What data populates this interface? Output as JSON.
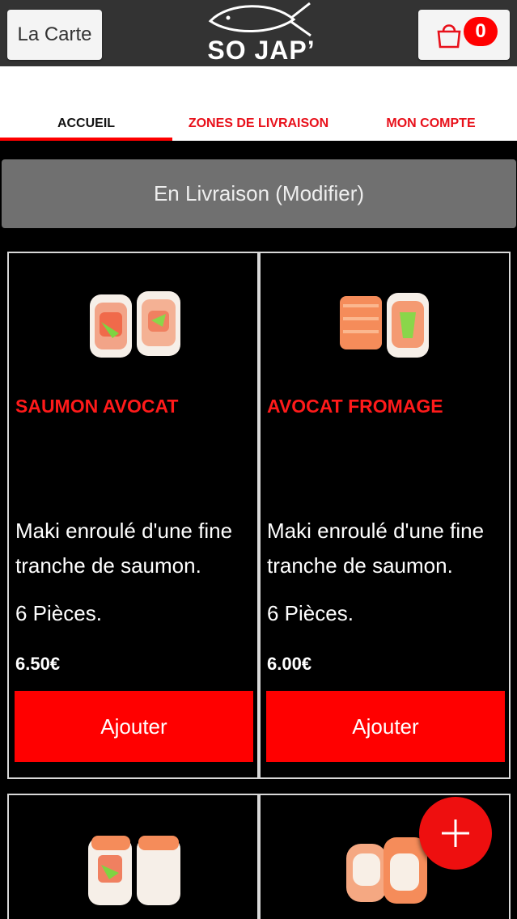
{
  "header": {
    "menu_button": "La Carte",
    "logo_text": "SO JAP’",
    "cart_count": "0"
  },
  "tabs": [
    {
      "label": "ACCUEIL",
      "active": true
    },
    {
      "label": "ZONES DE LIVRAISON",
      "active": false
    },
    {
      "label": "MON COMPTE",
      "active": false
    }
  ],
  "mode_bar": {
    "label": "En Livraison (Modifier)"
  },
  "products": [
    {
      "name": "SAUMON AVOCAT",
      "description": "Maki enroulé d'une fine tranche de saumon.",
      "pieces": "6 Pièces.",
      "price": "6.50€",
      "add_label": "Ajouter"
    },
    {
      "name": "AVOCAT FROMAGE",
      "description": "Maki enroulé d'une fine tranche de saumon.",
      "pieces": "6 Pièces.",
      "price": "6.00€",
      "add_label": "Ajouter"
    }
  ],
  "colors": {
    "accent": "#ff0000",
    "header_bg": "#333333",
    "mode_bar_bg": "#707070"
  },
  "icons": {
    "cart": "shopping-bag-icon",
    "fab": "plus-icon",
    "logo": "fish-logo-icon"
  }
}
